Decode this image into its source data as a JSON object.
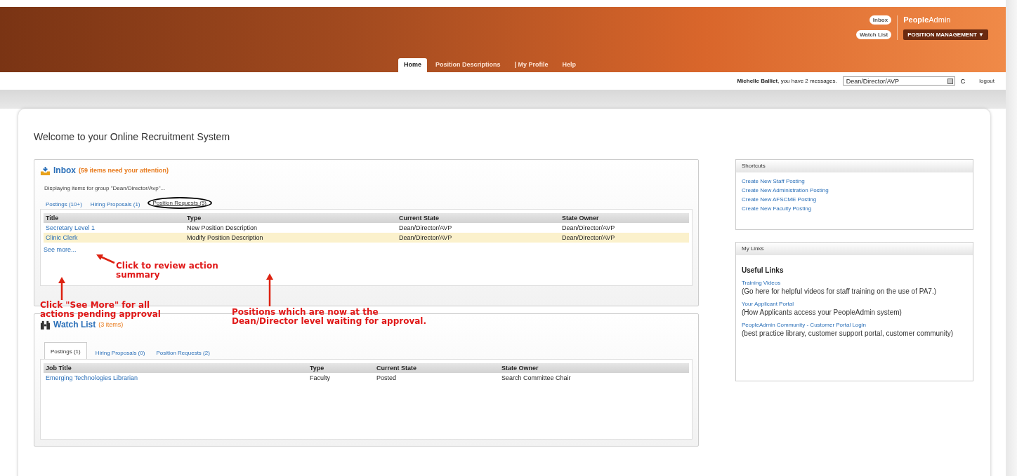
{
  "header": {
    "top_links": [
      {
        "label": "Inbox"
      },
      {
        "label": "Watch List"
      }
    ],
    "brand": {
      "bold": "People",
      "light": "Admin"
    },
    "module_menu": {
      "label": "POSITION MANAGEMENT",
      "caret": "▼"
    },
    "nav": [
      {
        "label": "Home",
        "selected": true
      },
      {
        "label": "Position Descriptions",
        "selected": false
      },
      {
        "label": "| My Profile",
        "selected": false
      },
      {
        "label": "Help",
        "selected": false
      }
    ]
  },
  "user_bar": {
    "name": "Michelle Balliet",
    "message": ", you have 2 messages.",
    "group_select": "Dean/Director/AVP",
    "refresh": "C",
    "logout": "logout"
  },
  "welcome": "Welcome to your Online Recruitment System",
  "inbox": {
    "title": "Inbox",
    "note": "(59 items need your attention)",
    "group_note": "Displaying items for group \"Dean/Director/Avp\"...",
    "tabs": [
      {
        "label": "Postings (10+)",
        "selected": false
      },
      {
        "label": "Hiring Proposals (1)",
        "selected": false
      },
      {
        "label": "Position Requests (5)",
        "selected": true
      }
    ],
    "columns": [
      "Title",
      "Type",
      "Current State",
      "State Owner"
    ],
    "rows": [
      {
        "cells": [
          "Secretary Level 1",
          "New Position Description",
          "Dean/Director/AVP",
          "Dean/Director/AVP"
        ],
        "highlighted": false
      },
      {
        "cells": [
          "Clinic Clerk",
          "Modify Position Description",
          "Dean/Director/AVP",
          "Dean/Director/AVP"
        ],
        "highlighted": true
      }
    ],
    "see_more": "See more..."
  },
  "watch_list": {
    "title": "Watch List",
    "note": "(3 items)",
    "tabs": [
      {
        "label": "Postings (1)",
        "selected": true
      },
      {
        "label": "Hiring Proposals (0)",
        "selected": false
      },
      {
        "label": "Position Requests (2)",
        "selected": false
      }
    ],
    "columns": [
      "Job Title",
      "Type",
      "Current State",
      "State Owner"
    ],
    "rows": [
      {
        "cells": [
          "Emerging Technologies Librarian",
          "Faculty",
          "Posted",
          "Search Committee Chair"
        ],
        "highlighted": false
      }
    ]
  },
  "shortcuts": {
    "title": "Shortcuts",
    "links": [
      "Create New Staff Posting",
      "Create New Administration Posting",
      "Create New AFSCME Posting",
      "Create New Faculty Posting"
    ]
  },
  "my_links": {
    "title": "My Links",
    "heading": "Useful Links",
    "items": [
      {
        "link": "Training Videos",
        "text": "(Go here for helpful videos for staff training on the use of PA7.)"
      },
      {
        "link": "Your Applicant Portal",
        "text": "(How Applicants access your PeopleAdmin system)"
      },
      {
        "link": "PeopleAdmin Community - Customer Portal Login",
        "text": " (best practice library, customer support portal, customer community)"
      }
    ]
  },
  "annotations": [
    {
      "kind": "review",
      "lines": [
        "Click to review action",
        "summary"
      ]
    },
    {
      "kind": "see_more",
      "lines": [
        "Click \"See More\" for all",
        "actions pending approval"
      ]
    },
    {
      "kind": "positions",
      "lines": [
        "Positions which are now at the",
        "Dean/Director level waiting for approval."
      ]
    }
  ]
}
